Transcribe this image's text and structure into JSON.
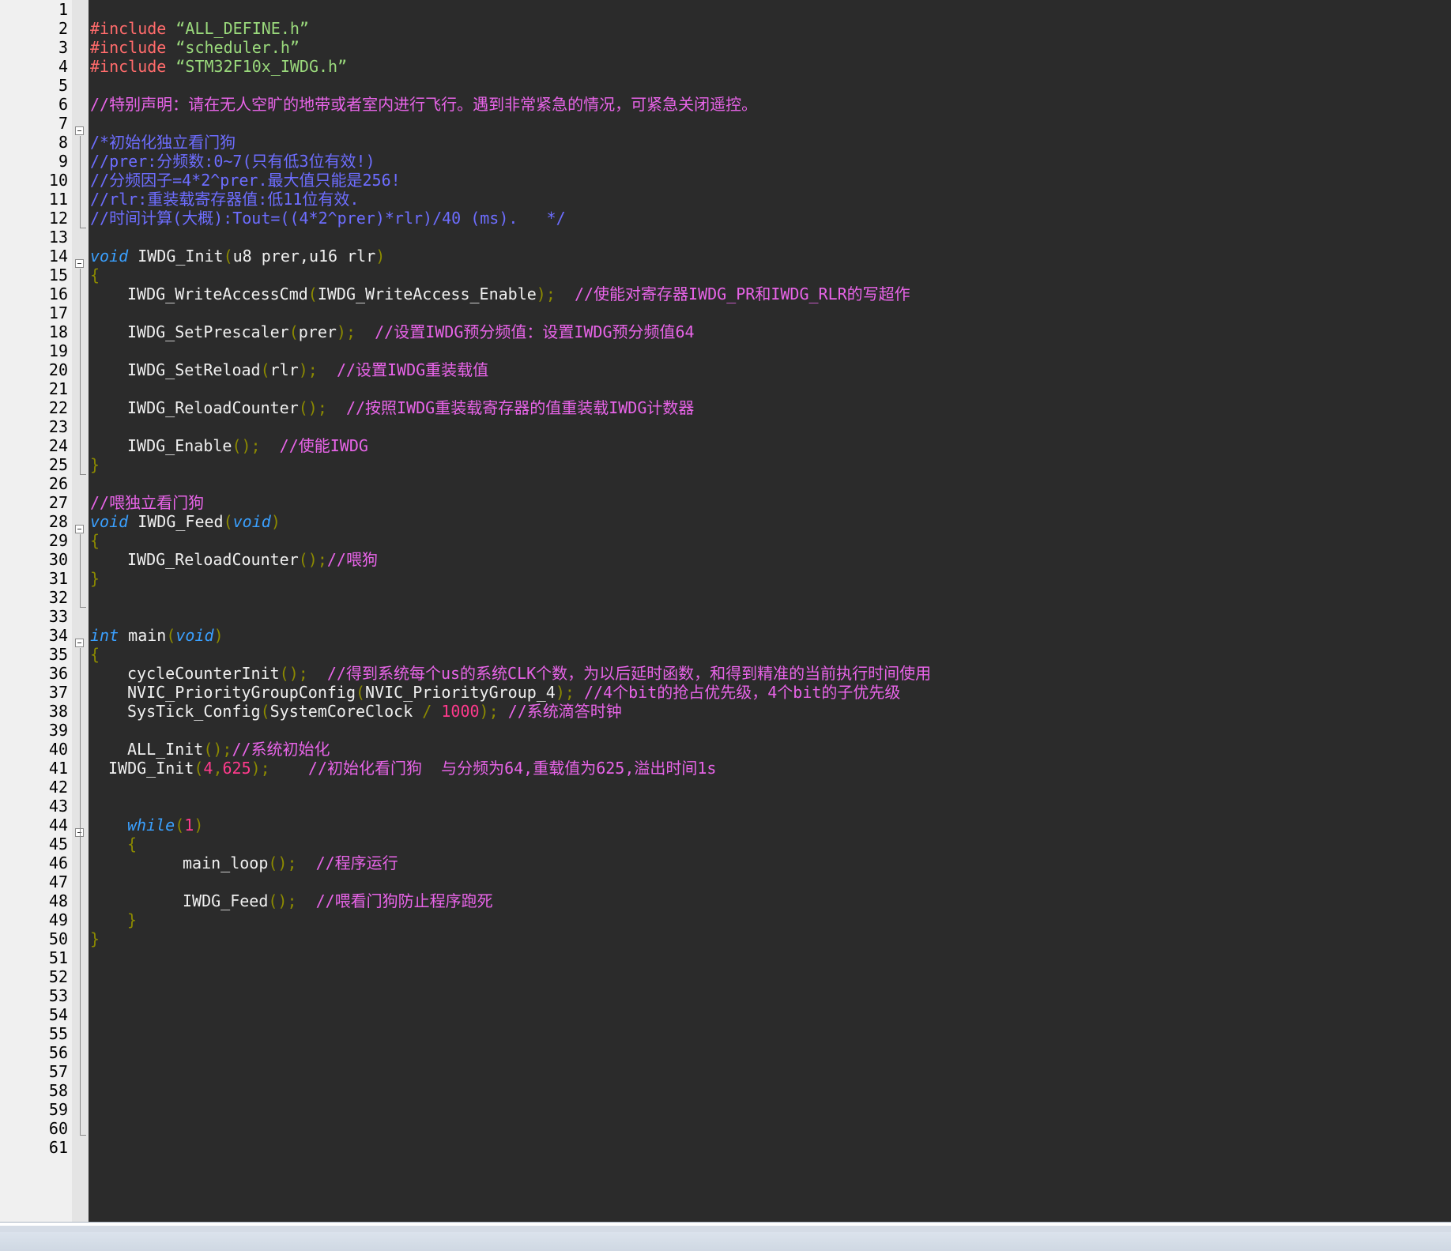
{
  "editor": {
    "line_numbers": [
      "1",
      "2",
      "3",
      "4",
      "5",
      "6",
      "7",
      "8",
      "9",
      "10",
      "11",
      "12",
      "13",
      "14",
      "15",
      "16",
      "17",
      "18",
      "19",
      "20",
      "21",
      "22",
      "23",
      "24",
      "25",
      "26",
      "27",
      "28",
      "29",
      "30",
      "31",
      "32",
      "33",
      "34",
      "35",
      "36",
      "37",
      "38",
      "39",
      "40",
      "41",
      "42",
      "43",
      "44",
      "45",
      "46",
      "47",
      "48",
      "49",
      "50",
      "51",
      "52",
      "53",
      "54",
      "55",
      "56",
      "57",
      "58",
      "59",
      "60",
      "61"
    ],
    "colors": {
      "background": "#2b2b2b",
      "gutter": "#f0f0f0",
      "preprocessor": "#ff6b6b",
      "string": "#9ad97c",
      "comment": "#e864e8",
      "block_comment": "#6d6dff",
      "keyword": "#3aa0ff",
      "punctuation": "#8c8a00",
      "number": "#ff3a8c"
    },
    "code": {
      "l2": {
        "directive": "#include",
        "file": "“ALL_DEFINE.h”"
      },
      "l3": {
        "directive": "#include",
        "file": "“scheduler.h”"
      },
      "l4": {
        "directive": "#include",
        "file": "“STM32F10x_IWDG.h”"
      },
      "l6": {
        "comment": "//特别声明：请在无人空旷的地带或者室内进行飞行。遇到非常紧急的情况，可紧急关闭遥控。"
      },
      "l8": {
        "comment": "/*初始化独立看门狗"
      },
      "l9": {
        "comment": "//prer:分频数:0~7(只有低3位有效!)"
      },
      "l10": {
        "comment": "//分频因子=4*2^prer.最大值只能是256!"
      },
      "l11": {
        "comment": "//rlr:重装载寄存器值:低11位有效."
      },
      "l12": {
        "comment": "//时间计算(大概):Tout=((4*2^prer)*rlr)/40 (ms).   */"
      },
      "l14": {
        "kw": "void",
        "name": "IWDG_Init",
        "open": "(",
        "params": "u8 prer,u16 rlr",
        "close": ")"
      },
      "l15": {
        "brace": "{"
      },
      "l16": {
        "call": "IWDG_WriteAccessCmd",
        "open": "(",
        "arg": "IWDG_WriteAccess_Enable",
        "close": ");",
        "comment": "//使能对寄存器IWDG_PR和IWDG_RLR的写超作"
      },
      "l18": {
        "call": "IWDG_SetPrescaler",
        "open": "(",
        "arg": "prer",
        "close": ");",
        "comment": "//设置IWDG预分频值：设置IWDG预分频值64"
      },
      "l20": {
        "call": "IWDG_SetReload",
        "open": "(",
        "arg": "rlr",
        "close": ");",
        "comment": "//设置IWDG重装载值"
      },
      "l22": {
        "call": "IWDG_ReloadCounter",
        "punct": "();",
        "comment": "//按照IWDG重装载寄存器的值重装载IWDG计数器"
      },
      "l24": {
        "call": "IWDG_Enable",
        "punct": "();",
        "comment": "//使能IWDG"
      },
      "l25": {
        "brace": "}"
      },
      "l27": {
        "comment": "//喂独立看门狗"
      },
      "l28": {
        "kw": "void",
        "name": "IWDG_Feed",
        "open": "(",
        "kw2": "void",
        "close": ")"
      },
      "l29": {
        "brace": "{"
      },
      "l30": {
        "call": "IWDG_ReloadCounter",
        "punct": "();",
        "comment": "//喂狗"
      },
      "l31": {
        "brace": "}"
      },
      "l34": {
        "kw": "int",
        "name": "main",
        "open": "(",
        "kw2": "void",
        "close": ")"
      },
      "l35": {
        "brace": "{"
      },
      "l36": {
        "call": "cycleCounterInit",
        "punct": "();",
        "comment": "//得到系统每个us的系统CLK个数，为以后延时函数，和得到精准的当前执行时间使用"
      },
      "l37": {
        "call": "NVIC_PriorityGroupConfig",
        "open": "(",
        "arg": "NVIC_PriorityGroup_4",
        "close": ");",
        "comment": "//4个bit的抢占优先级，4个bit的子优先级"
      },
      "l38": {
        "call": "SysTick_Config",
        "open": "(",
        "arg": "SystemCoreClock",
        "op": " / ",
        "num": "1000",
        "close": ");",
        "comment": "//系统滴答时钟"
      },
      "l40": {
        "call": "ALL_Init",
        "punct": "();",
        "comment": "//系统初始化"
      },
      "l41": {
        "call": "IWDG_Init",
        "open": "(",
        "num1": "4",
        "comma": ",",
        "num2": "625",
        "close": ");",
        "comment": "//初始化看门狗  与分频为64,重载值为625,溢出时间1s"
      },
      "l44": {
        "kw": "while",
        "open": "(",
        "num": "1",
        "close": ")"
      },
      "l45": {
        "brace": "{"
      },
      "l46": {
        "call": "main_loop",
        "punct": "();",
        "comment": "//程序运行"
      },
      "l48": {
        "call": "IWDG_Feed",
        "punct": "();",
        "comment": "//喂看门狗防止程序跑死"
      },
      "l49": {
        "brace": "}"
      },
      "l50": {
        "brace": "}"
      }
    }
  }
}
